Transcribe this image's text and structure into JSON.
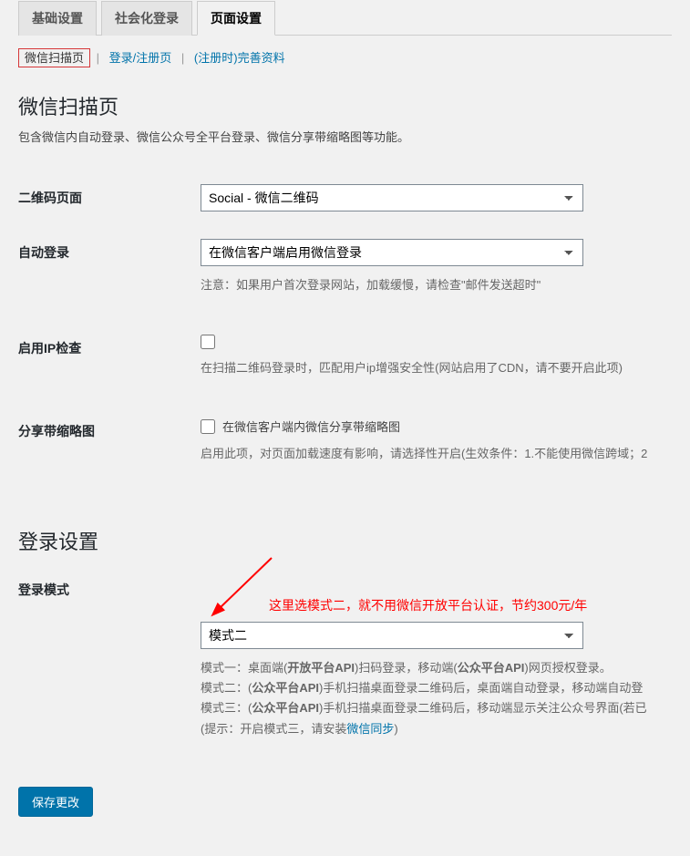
{
  "tabs": {
    "basic": "基础设置",
    "social": "社会化登录",
    "page": "页面设置"
  },
  "subtabs": {
    "wechat_scan": "微信扫描页",
    "login_reg": "登录/注册页",
    "complete_profile": "(注册时)完善资料"
  },
  "section1": {
    "title": "微信扫描页",
    "desc": "包含微信内自动登录、微信公众号全平台登录、微信分享带缩略图等功能。"
  },
  "qr_page": {
    "label": "二维码页面",
    "value": "Social - 微信二维码"
  },
  "auto_login": {
    "label": "自动登录",
    "value": "在微信客户端启用微信登录",
    "note": "注意：如果用户首次登录网站，加载缓慢，请检查\"邮件发送超时\""
  },
  "ip_check": {
    "label": "启用IP检查",
    "note": "在扫描二维码登录时，匹配用户ip增强安全性(网站启用了CDN，请不要开启此项)"
  },
  "share_thumb": {
    "label": "分享带缩略图",
    "checkbox_label": "在微信客户端内微信分享带缩略图",
    "note": "启用此项，对页面加载速度有影响，请选择性开启(生效条件：1.不能使用微信跨域；2"
  },
  "section2": {
    "title": "登录设置"
  },
  "annotation": {
    "text": "这里选模式二，就不用微信开放平台认证，节约300元/年"
  },
  "login_mode": {
    "label": "登录模式",
    "value": "模式二",
    "note_line1_a": "模式一：桌面端(",
    "note_line1_b": "开放平台API",
    "note_line1_c": ")扫码登录，移动端(",
    "note_line1_d": "公众平台API",
    "note_line1_e": ")网页授权登录。",
    "note_line2_a": "模式二：(",
    "note_line2_b": "公众平台API",
    "note_line2_c": ")手机扫描桌面登录二维码后，桌面端自动登录，移动端自动登",
    "note_line3_a": "模式三：(",
    "note_line3_b": "公众平台API",
    "note_line3_c": ")手机扫描桌面登录二维码后，移动端显示关注公众号界面(若已",
    "note_line4_a": "(提示：开启模式三，请安装",
    "note_line4_link": "微信同步",
    "note_line4_b": ")"
  },
  "save_button": "保存更改",
  "separator": "|"
}
